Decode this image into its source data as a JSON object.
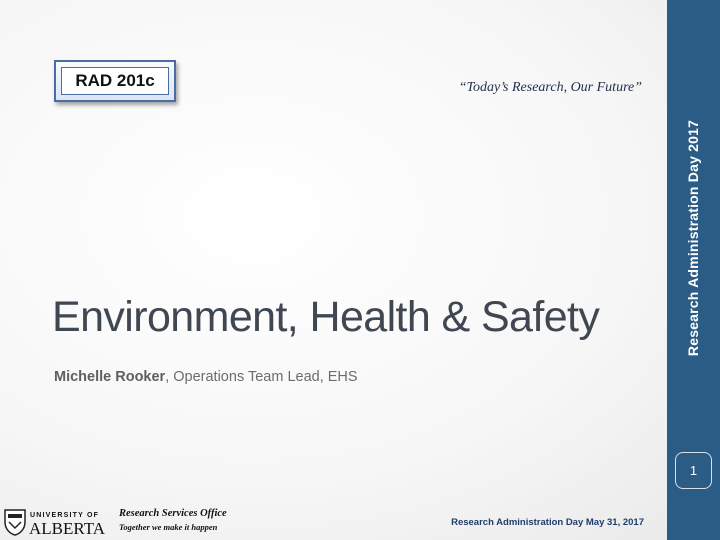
{
  "slide": {
    "badge_label": "RAD 201c",
    "tagline": "“Today’s Research, Our Future”",
    "title": "Environment, Health & Safety",
    "presenter_name": "Michelle Rooker",
    "presenter_role": ", Operations Team Lead, EHS",
    "page_number": "1"
  },
  "sidebar": {
    "vertical_text": "Research Administration Day 2017"
  },
  "footer": {
    "logo_top_text": "UNIVERSITY OF",
    "logo_bottom_text": "ALBERTA",
    "org_name": "Research Services Office",
    "org_slogan": "Together we make it happen",
    "event_date": "Research Administration Day May 31, 2017"
  },
  "colors": {
    "sidebar": "#2b5c86",
    "title": "#3f4752",
    "footer_text": "#1f3d6b"
  }
}
